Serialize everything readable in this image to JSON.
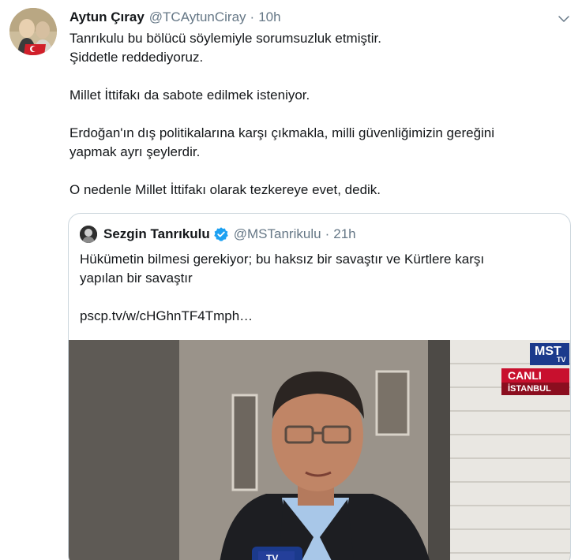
{
  "tweet": {
    "author": {
      "name": "Aytun Çıray",
      "handle": "@TCAytunCiray"
    },
    "separator": "·",
    "time": "10h",
    "body": {
      "line1": "Tanrıkulu bu bölücü söylemiyle sorumsuzluk etmiştir.",
      "line2": "Şiddetle reddediyoruz.",
      "line3": "Millet İttifakı da sabote edilmek isteniyor.",
      "line4": "Erdoğan'ın dış politikalarına karşı çıkmakla, milli güvenliğimizin gereğini",
      "line5": "yapmak ayrı şeylerdir.",
      "line6": "O nedenle Millet İttifakı olarak tezkereye evet, dedik."
    },
    "caret_icon": "chevron-down-icon"
  },
  "quoted": {
    "author": {
      "name": "Sezgin Tanrıkulu",
      "handle": "@MSTanrikulu",
      "verified": true
    },
    "separator": "·",
    "time": "21h",
    "text": {
      "line1": "Hükümetin bilmesi gerekiyor; bu haksız bir savaştır ve Kürtlere karşı",
      "line2": "yapılan bir savaştır",
      "link": "pscp.tv/w/cHGhnTF4Tmph…"
    },
    "media": {
      "channel_logo": "MST",
      "channel_sub": "TV",
      "live_label": "CANLI",
      "location_label": "İSTANBUL",
      "mic_label": "TV"
    }
  },
  "colors": {
    "text": "#14171a",
    "secondary": "#657786",
    "border": "#ccd6dd",
    "verified": "#1da1f2",
    "live_red": "#c8102e"
  }
}
